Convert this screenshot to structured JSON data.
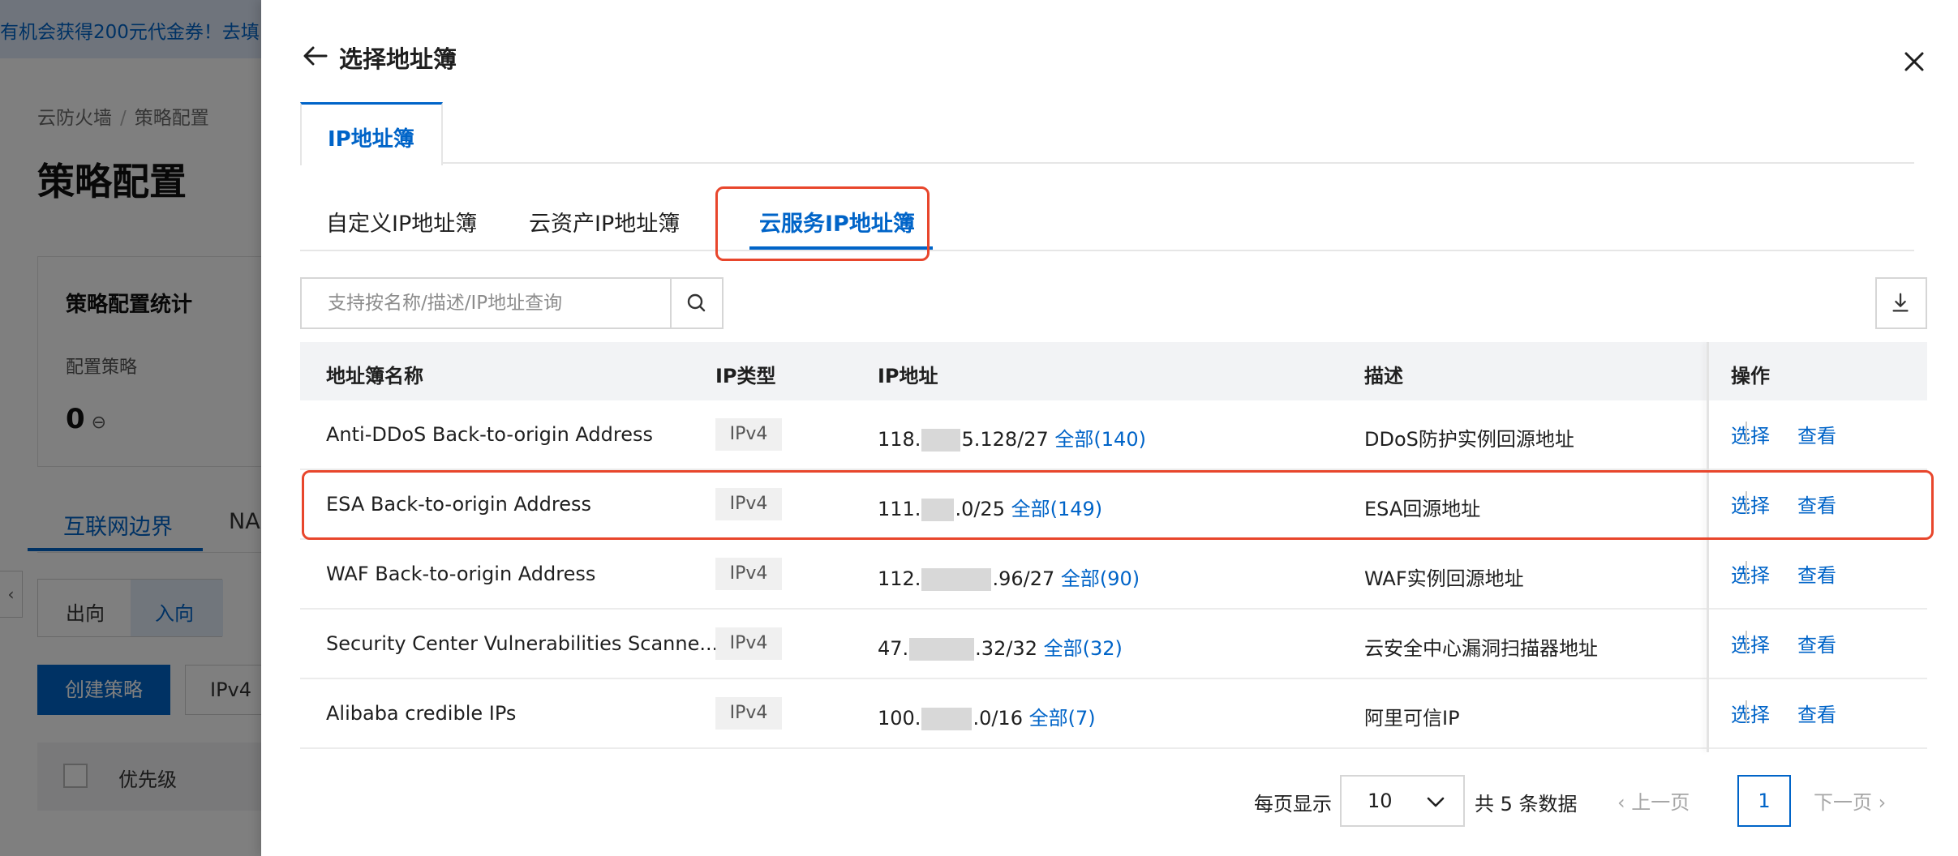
{
  "background": {
    "banner_text": "有机会获得200元代金券！去填",
    "breadcrumb": [
      "云防火墙",
      "策略配置"
    ],
    "page_title": "策略配置",
    "stats_card": {
      "title": "策略配置统计",
      "label": "配置策略",
      "value": "0"
    },
    "tabs": [
      "互联网边界",
      "NA"
    ],
    "direction": {
      "out": "出向",
      "in": "入向"
    },
    "create_button": "创建策略",
    "ip_filter": "IPv4",
    "table_header_priority": "优先级",
    "collapse_icon": "chevron-left-icon"
  },
  "drawer": {
    "title": "选择地址簿",
    "top_tab": "IP地址簿",
    "sub_tabs": [
      "自定义IP地址簿",
      "云资产IP地址簿",
      "云服务IP地址簿"
    ],
    "active_sub_tab": "云服务IP地址簿",
    "search_placeholder": "支持按名称/描述/IP地址查询",
    "columns": [
      "地址簿名称",
      "IP类型",
      "IP地址",
      "描述",
      "操作"
    ],
    "rows": [
      {
        "name": "Anti-DDoS Back-to-origin Address",
        "ip_type": "IPv4",
        "ip_prefix": "118.",
        "ip_suffix": "5.128/27",
        "all_link": "全部(140)",
        "desc": "DDoS防护实例回源地址",
        "select": "选择",
        "view": "查看"
      },
      {
        "name": "ESA Back-to-origin Address",
        "ip_type": "IPv4",
        "ip_prefix": "111.",
        "ip_suffix": ".0/25",
        "all_link": "全部(149)",
        "desc": "ESA回源地址",
        "select": "选择",
        "view": "查看"
      },
      {
        "name": "WAF Back-to-origin Address",
        "ip_type": "IPv4",
        "ip_prefix": "112.",
        "ip_suffix": ".96/27",
        "all_link": "全部(90)",
        "desc": "WAF实例回源地址",
        "select": "选择",
        "view": "查看"
      },
      {
        "name": "Security Center Vulnerabilities Scanne...",
        "ip_type": "IPv4",
        "ip_prefix": "47.",
        "ip_suffix": ".32/32",
        "all_link": "全部(32)",
        "desc": "云安全中心漏洞扫描器地址",
        "select": "选择",
        "view": "查看"
      },
      {
        "name": "Alibaba credible IPs",
        "ip_type": "IPv4",
        "ip_prefix": "100.",
        "ip_suffix": ".0/16",
        "all_link": "全部(7)",
        "desc": "阿里可信IP",
        "select": "选择",
        "view": "查看"
      }
    ],
    "pagination": {
      "per_page_label": "每页显示",
      "per_page_value": "10",
      "total": "共 5 条数据",
      "prev": "上一页",
      "current_page": "1",
      "next": "下一页"
    },
    "colors": {
      "accent": "#0064c8",
      "highlight": "#e8462c"
    }
  }
}
